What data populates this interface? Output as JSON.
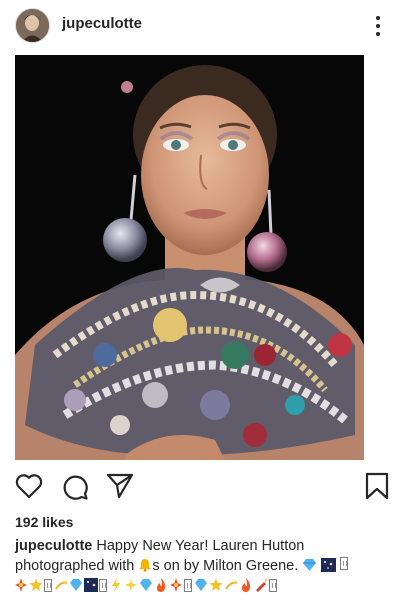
{
  "post": {
    "username": "jupeculotte",
    "likes_text": "192 likes",
    "caption": {
      "user": "jupeculotte",
      "text_before_bell": "Happy New Year! Lauren Hutton photographed with",
      "bell_icon": "bell-emoji",
      "text_after_bell": "s on by Milton Greene.",
      "trailing_emoji": [
        "gem",
        "night-sky",
        "missing-glyph"
      ]
    },
    "emoji_row": [
      "sparkle-burst",
      "star",
      "missing-glyph",
      "dizzy",
      "gem",
      "night-sky",
      "missing-glyph",
      "zap",
      "sparkler",
      "gem",
      "fire",
      "sparkle-burst",
      "missing-glyph",
      "gem",
      "star",
      "dizzy",
      "fire",
      "firecracker",
      "missing-glyph"
    ]
  },
  "icons": {
    "more": "more-vertical-icon",
    "like": "heart-outline-icon",
    "comment": "comment-icon",
    "share": "paper-plane-icon",
    "save": "bookmark-icon"
  },
  "colors": {
    "text": "#262626",
    "image_bg": "#070707",
    "divider": "#dbdbdb"
  }
}
